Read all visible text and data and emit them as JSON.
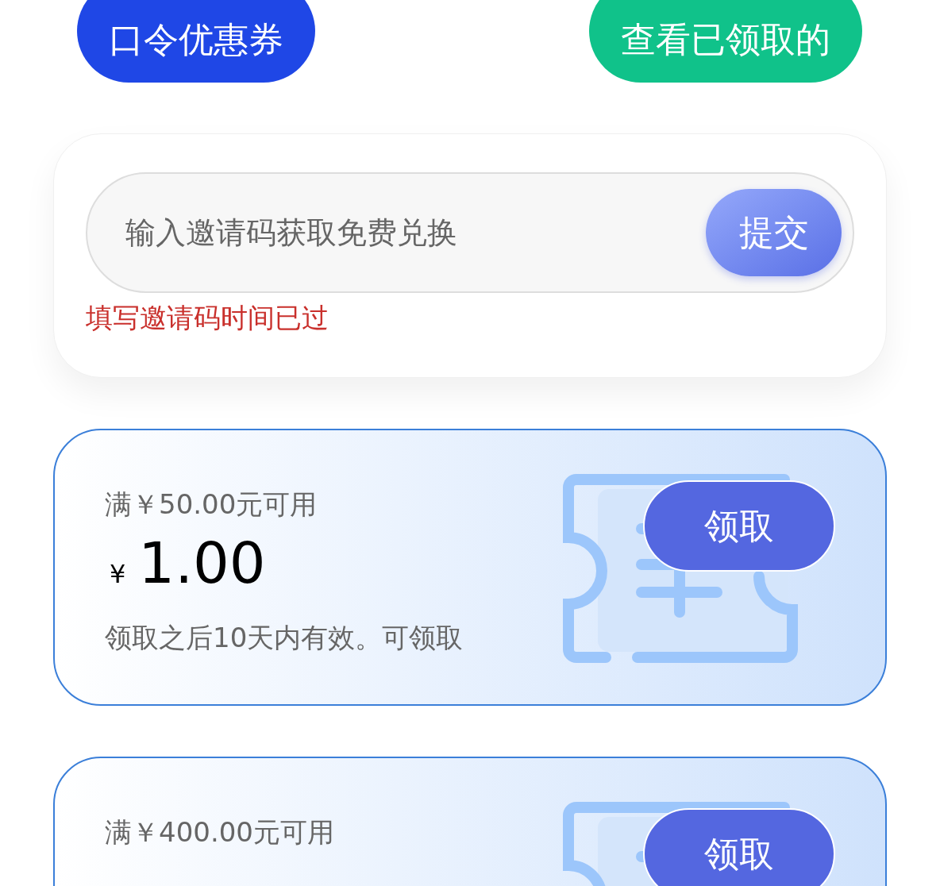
{
  "top_buttons": [
    {
      "label": "口令优惠券",
      "kind": "primary"
    },
    {
      "label": "查看已领取的",
      "kind": "success"
    }
  ],
  "invite": {
    "placeholder": "输入邀请码获取免费兑换",
    "submit": "提交",
    "error": "填写邀请码时间已过"
  },
  "coupons": [
    {
      "condition": "满￥50.00元可用",
      "currency": "¥",
      "amount": "1.00",
      "note": "领取之后10天内有效。可领取",
      "button": "领取"
    },
    {
      "condition": "满￥400.00元可用",
      "button": "领取"
    }
  ]
}
